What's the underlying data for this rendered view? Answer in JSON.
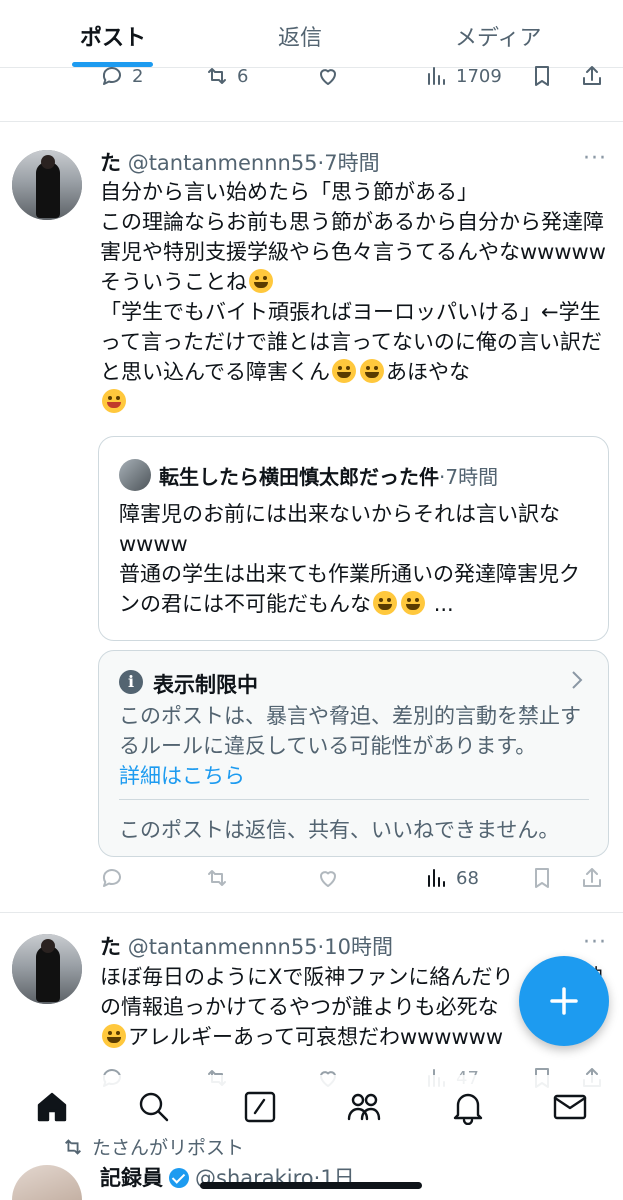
{
  "tabs": [
    {
      "label": "ポスト",
      "active": true
    },
    {
      "label": "返信",
      "active": false
    },
    {
      "label": "メディア",
      "active": false
    }
  ],
  "prev_actions": {
    "reply": "2",
    "repost": "6",
    "like": "",
    "views": "1709"
  },
  "tweet1": {
    "name": "た",
    "handle": "@tantanmennn55",
    "time": "·7時間",
    "text": "自分から言い始めたら「思う節がある」\nこの理論ならお前も思う節があるから自分から発達障害児や特別支援学級やら色々言うてるんやなwwwwwそういうことね",
    "text2": "\n「学生でもバイト頑張ればヨーロッパいける」←学生って言っただけで誰とは言ってないのに俺の言い訳だと思い込んでる障害くん",
    "text3": "あほやな",
    "quote": {
      "name": "転生したら横田慎太郎だった件",
      "time": "·7時間",
      "text": "障害児のお前には出来ないからそれは言い訳なwwww\n普通の学生は出来ても作業所通いの発達障害児クンの君には不可能だもんな",
      "ellipsis": "..."
    },
    "notice": {
      "title": "表示制限中",
      "body": "このポストは、暴言や脅迫、差別的言動を禁止するルールに違反している可能性があります。",
      "link": "詳細はこちら",
      "footer": "このポストは返信、共有、いいねできません。"
    },
    "views": "68"
  },
  "tweet2": {
    "name": "た",
    "handle": "@tantanmennn55",
    "time": "·10時間",
    "text_a": "ほぼ毎日のようにXで阪神ファンに絡んだり",
    "text_b": "神",
    "text_c": "の情報追っかけてるやつが誰よりも必死な",
    "text_d": "アレルギーあって可哀想だわwwwwww",
    "views": "47"
  },
  "retweet_peek": {
    "label": "たさんがリポスト",
    "name": "記録員",
    "handle": "@sharakiro",
    "time": "·1日"
  },
  "icons": {
    "reply": "reply-icon",
    "repost": "repost-icon",
    "like": "heart-icon",
    "views": "views-icon",
    "bookmark": "bookmark-icon",
    "share": "share-icon",
    "home": "home-icon",
    "search": "search-icon",
    "compose": "compose-icon",
    "communities": "communities-icon",
    "notifications": "bell-icon",
    "messages": "mail-icon"
  },
  "colors": {
    "accent": "#1d9bf0",
    "text": "#0f1419",
    "muted": "#536471"
  }
}
